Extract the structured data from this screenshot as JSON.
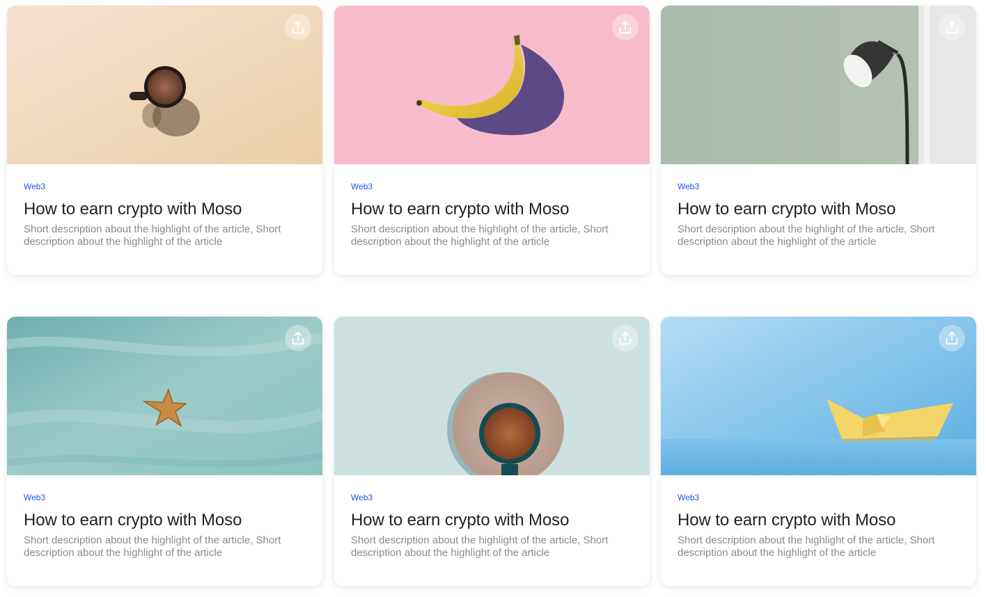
{
  "icons": {
    "share": "share-upload-icon"
  },
  "colors": {
    "tag": "#1a56db",
    "title": "#222222",
    "description": "#8a8a8a"
  },
  "cards": [
    {
      "tag": "Web3",
      "title": "How to earn crypto with Moso",
      "description": "Short description about the highlight of the article, Short description about the highlight of the article",
      "image": "coffee-cup-on-beige",
      "background": "#f0d6b6"
    },
    {
      "tag": "Web3",
      "title": "How to earn crypto with Moso",
      "description": "Short description about the highlight of the article, Short description about the highlight of the article",
      "image": "banana-on-pink",
      "background": "#f7bccb"
    },
    {
      "tag": "Web3",
      "title": "How to earn crypto with Moso",
      "description": "Short description about the highlight of the article, Short description about the highlight of the article",
      "image": "floor-lamp-on-sage-wall",
      "background": "#adbcae"
    },
    {
      "tag": "Web3",
      "title": "How to earn crypto with Moso",
      "description": "Short description about the highlight of the article, Short description about the highlight of the article",
      "image": "starfish-on-sand",
      "background": "#8fbfbf"
    },
    {
      "tag": "Web3",
      "title": "How to earn crypto with Moso",
      "description": "Short description about the highlight of the article, Short description about the highlight of the article",
      "image": "coffee-cup-top-view",
      "background": "#cde0e0"
    },
    {
      "tag": "Web3",
      "title": "How to earn crypto with Moso",
      "description": "Short description about the highlight of the article, Short description about the highlight of the article",
      "image": "paper-boat-on-blue",
      "background": "#8dc6ec"
    }
  ]
}
